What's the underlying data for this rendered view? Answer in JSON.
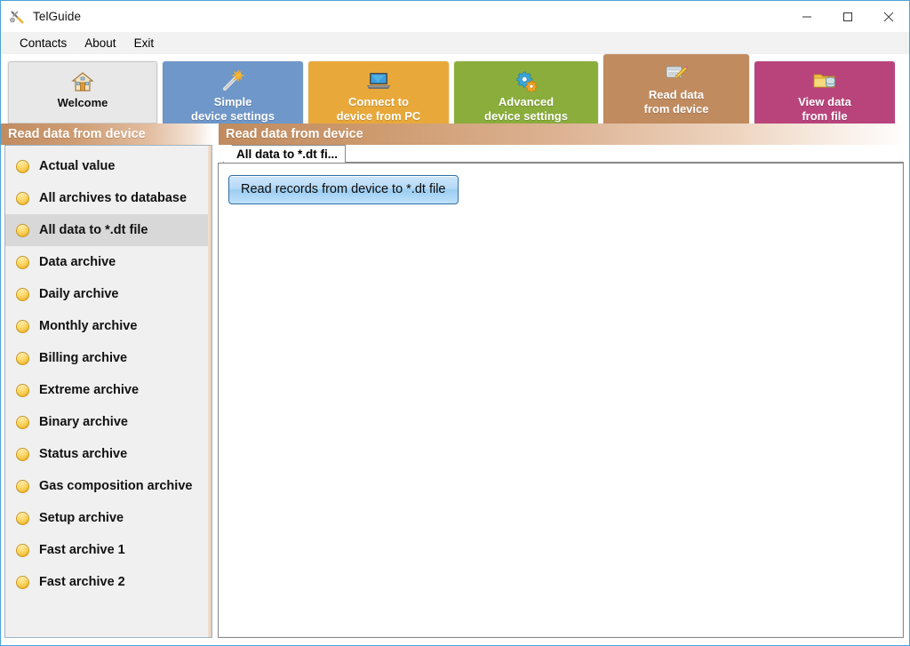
{
  "window": {
    "title": "TelGuide",
    "app_icon": "tools-icon",
    "controls": [
      {
        "name": "minimize",
        "glyph": "minimize-icon"
      },
      {
        "name": "maximize",
        "glyph": "maximize-icon"
      },
      {
        "name": "close",
        "glyph": "close-icon"
      }
    ]
  },
  "menubar": {
    "items": [
      {
        "label": "Contacts"
      },
      {
        "label": "About"
      },
      {
        "label": "Exit"
      }
    ]
  },
  "nav": {
    "tabs": [
      {
        "label_line1": "Welcome",
        "label_line2": "",
        "icon": "house-icon",
        "color": "#e8e8e8",
        "active": false
      },
      {
        "label_line1": "Simple",
        "label_line2": "device settings",
        "icon": "magic-wand-icon",
        "color": "#6f97c9",
        "active": false
      },
      {
        "label_line1": "Connect to",
        "label_line2": "device from PC",
        "icon": "laptop-icon",
        "color": "#e9a93a",
        "active": false
      },
      {
        "label_line1": "Advanced",
        "label_line2": "device settings",
        "icon": "gears-icon",
        "color": "#8aad3c",
        "active": false
      },
      {
        "label_line1": "Read data",
        "label_line2": "from device",
        "icon": "note-pencil-icon",
        "color": "#c08b5f",
        "active": true
      },
      {
        "label_line1": "View data",
        "label_line2": "from file",
        "icon": "folder-database-icon",
        "color": "#b9447c",
        "active": false
      }
    ]
  },
  "header": {
    "sidebar_title": "Read data from device",
    "main_title": "Read data from device",
    "accent": "#c08b5f"
  },
  "sidebar": {
    "items": [
      {
        "label": "Actual value",
        "selected": false
      },
      {
        "label": "All archives to database",
        "selected": false
      },
      {
        "label": "All data to *.dt file",
        "selected": true
      },
      {
        "label": "Data archive",
        "selected": false
      },
      {
        "label": "Daily archive",
        "selected": false
      },
      {
        "label": "Monthly archive",
        "selected": false
      },
      {
        "label": "Billing archive",
        "selected": false
      },
      {
        "label": "Extreme archive",
        "selected": false
      },
      {
        "label": "Binary archive",
        "selected": false
      },
      {
        "label": "Status archive",
        "selected": false
      },
      {
        "label": "Gas composition archive",
        "selected": false
      },
      {
        "label": "Setup archive",
        "selected": false
      },
      {
        "label": "Fast archive 1",
        "selected": false
      },
      {
        "label": "Fast archive 2",
        "selected": false
      }
    ]
  },
  "main": {
    "tab": {
      "label": "All data to *.dt fi...",
      "active": true
    },
    "action_button": {
      "label": "Read records from device to *.dt file"
    }
  }
}
